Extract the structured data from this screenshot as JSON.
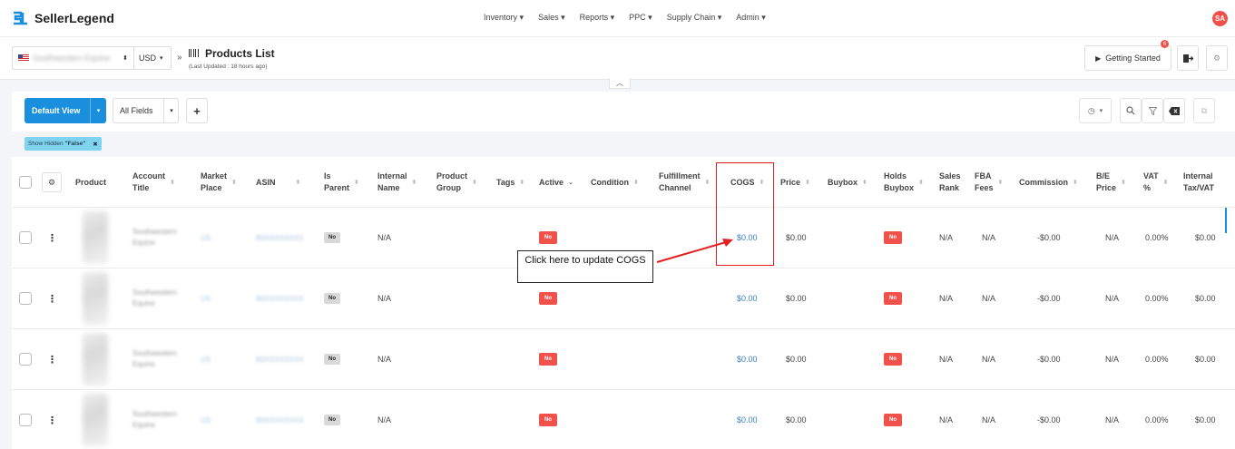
{
  "app": {
    "name": "SellerLegend",
    "user_initials": "SA"
  },
  "nav": {
    "items": [
      "Inventory",
      "Sales",
      "Reports",
      "PPC",
      "Supply Chain",
      "Admin"
    ]
  },
  "subheader": {
    "store_name": "Southwestern Equine",
    "currency": "USD",
    "breadcrumb_sep": "»",
    "page_title": "Products List",
    "last_updated": "(Last Updated : 18 hours ago)",
    "getting_started": "Getting Started",
    "getting_started_badge": "6"
  },
  "toolbar": {
    "view_label": "Default View",
    "fields_label": "All Fields",
    "add_label": "+"
  },
  "filter": {
    "prefix": "Show Hidden",
    "value": "\"False\"",
    "remove": "✖"
  },
  "columns": {
    "product": "Product",
    "account_title_1": "Account",
    "account_title_2": "Title",
    "market_place_1": "Market",
    "market_place_2": "Place",
    "asin": "ASIN",
    "is_parent_1": "Is",
    "is_parent_2": "Parent",
    "internal_name_1": "Internal",
    "internal_name_2": "Name",
    "product_group_1": "Product",
    "product_group_2": "Group",
    "tags": "Tags",
    "active": "Active",
    "condition": "Condition",
    "fulfillment_1": "Fulfillment",
    "fulfillment_2": "Channel",
    "cogs": "COGS",
    "price": "Price",
    "buybox": "Buybox",
    "holds_buybox_1": "Holds",
    "holds_buybox_2": "Buybox",
    "sales_rank_1": "Sales",
    "sales_rank_2": "Rank",
    "fba_fees_1": "FBA",
    "fba_fees_2": "Fees",
    "commission": "Commission",
    "be_price_1": "B/E",
    "be_price_2": "Price",
    "vat_1": "VAT",
    "vat_2": "%",
    "internal_tax_1": "Internal",
    "internal_tax_2": "Tax/VAT"
  },
  "rows": [
    {
      "account_1": "Southwestern",
      "account_2": "Equine",
      "market": "US",
      "asin": "B0XXXXXXXX",
      "is_parent": "No",
      "internal_name": "N/A",
      "active": "No",
      "cogs": "$0.00",
      "price": "$0.00",
      "holds_buybox": "No",
      "sales_rank": "N/A",
      "fba_fees": "N/A",
      "commission": "-$0.00",
      "be_price": "N/A",
      "vat": "0.00%",
      "internal_tax": "$0.00"
    },
    {
      "account_1": "Southwestern",
      "account_2": "Equine",
      "market": "US",
      "asin": "B0XXXXXXXX",
      "is_parent": "No",
      "internal_name": "N/A",
      "active": "No",
      "cogs": "$0.00",
      "price": "$0.00",
      "holds_buybox": "No",
      "sales_rank": "N/A",
      "fba_fees": "N/A",
      "commission": "-$0.00",
      "be_price": "N/A",
      "vat": "0.00%",
      "internal_tax": "$0.00"
    },
    {
      "account_1": "Southwestern",
      "account_2": "Equine",
      "market": "US",
      "asin": "B0XXXXXXXX",
      "is_parent": "No",
      "internal_name": "N/A",
      "active": "No",
      "cogs": "$0.00",
      "price": "$0.00",
      "holds_buybox": "No",
      "sales_rank": "N/A",
      "fba_fees": "N/A",
      "commission": "-$0.00",
      "be_price": "N/A",
      "vat": "0.00%",
      "internal_tax": "$0.00"
    },
    {
      "account_1": "Southwestern",
      "account_2": "Equine",
      "market": "US",
      "asin": "B0XXXXXXXX",
      "is_parent": "No",
      "internal_name": "N/A",
      "active": "No",
      "cogs": "$0.00",
      "price": "$0.00",
      "holds_buybox": "No",
      "sales_rank": "N/A",
      "fba_fees": "N/A",
      "commission": "-$0.00",
      "be_price": "N/A",
      "vat": "0.00%",
      "internal_tax": "$0.00"
    }
  ],
  "annotation": {
    "callout_text": "Click here to update COGS",
    "color": "#e02020"
  }
}
